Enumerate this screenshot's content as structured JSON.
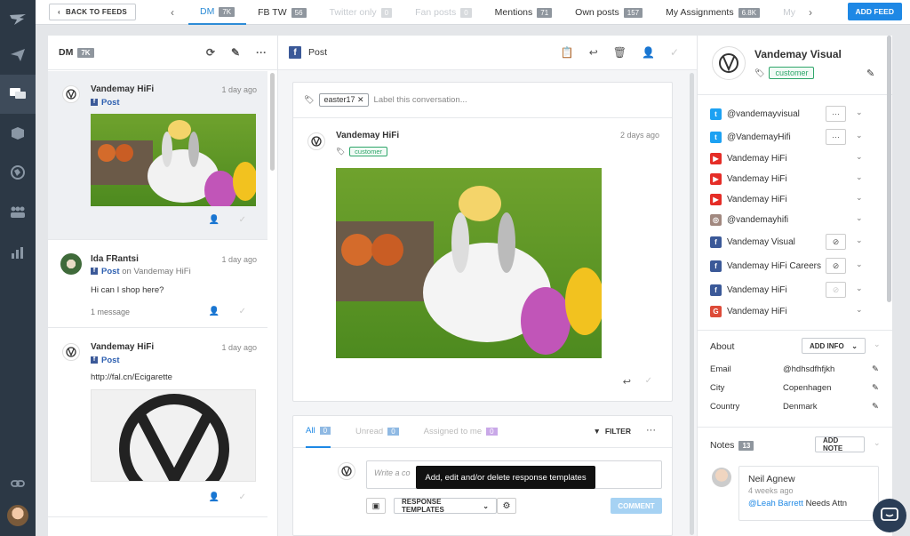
{
  "topbar": {
    "back_label": "BACK TO FEEDS",
    "tabs": [
      {
        "label": "DM",
        "count": "7K",
        "state": "active"
      },
      {
        "label": "FB TW",
        "count": "56",
        "state": "normal"
      },
      {
        "label": "Twitter only",
        "count": "0",
        "state": "disabled"
      },
      {
        "label": "Fan posts",
        "count": "0",
        "state": "disabled"
      },
      {
        "label": "Mentions",
        "count": "71",
        "state": "normal"
      },
      {
        "label": "Own posts",
        "count": "157",
        "state": "normal"
      },
      {
        "label": "My Assignments",
        "count": "6.8K",
        "state": "normal"
      },
      {
        "label": "My",
        "count": "",
        "state": "disabled"
      }
    ],
    "add_feed": "ADD FEED"
  },
  "feed": {
    "title": "DM",
    "count": "7K",
    "items": [
      {
        "name": "Vandemay HiFi",
        "time": "1 day ago",
        "type": "Post",
        "suffix": ""
      },
      {
        "name": "Ida FRantsi",
        "time": "1 day ago",
        "type": "Post",
        "suffix": "on Vandemay HiFi",
        "text": "Hi can I shop here?",
        "meta": "1 message"
      },
      {
        "name": "Vandemay HiFi",
        "time": "1 day ago",
        "type": "Post",
        "suffix": "",
        "text": "http://fal.cn/Ecigarette"
      }
    ]
  },
  "conversation": {
    "title": "Post",
    "tag": "easter17",
    "label_placeholder": "Label this conversation...",
    "post_author": "Vandemay HiFi",
    "post_time": "2 days ago",
    "post_tag": "customer",
    "tabs": [
      {
        "label": "All",
        "count": "0"
      },
      {
        "label": "Unread",
        "count": "0"
      },
      {
        "label": "Assigned to me",
        "count": "0"
      }
    ],
    "filter": "FILTER",
    "comment_placeholder": "Write a co",
    "tooltip": "Add, edit and/or delete response templates",
    "templates": "RESPONSE TEMPLATES",
    "comment_btn": "COMMENT"
  },
  "profile": {
    "name": "Vandemay Visual",
    "tag": "customer",
    "accounts": [
      {
        "net": "twitter",
        "name": "@vandemayvisual",
        "btn": "···"
      },
      {
        "net": "twitter",
        "name": "@VandemayHifi",
        "btn": "···"
      },
      {
        "net": "youtube",
        "name": "Vandemay HiFi",
        "btn": ""
      },
      {
        "net": "youtube",
        "name": "Vandemay HiFi",
        "btn": ""
      },
      {
        "net": "youtube",
        "name": "Vandemay HiFi",
        "btn": ""
      },
      {
        "net": "instagram",
        "name": "@vandemayhifi",
        "btn": ""
      },
      {
        "net": "facebook",
        "name": "Vandemay Visual",
        "btn": "⊘"
      },
      {
        "net": "facebook",
        "name": "Vandemay HiFi Careers",
        "btn": "⊘"
      },
      {
        "net": "facebook",
        "name": "Vandemay HiFi",
        "btn": "⊘"
      },
      {
        "net": "google",
        "name": "Vandemay HiFi",
        "btn": ""
      }
    ],
    "about_title": "About",
    "add_info": "ADD INFO",
    "about": [
      {
        "k": "Email",
        "v": "@hdhsdfhfjkh"
      },
      {
        "k": "City",
        "v": "Copenhagen"
      },
      {
        "k": "Country",
        "v": "Denmark"
      }
    ],
    "notes_title": "Notes",
    "notes_count": "13",
    "add_note": "ADD NOTE",
    "note_author": "Neil Agnew",
    "note_time": "4 weeks ago",
    "note_mention": "@Leah Barrett",
    "note_text": "Needs Attn"
  },
  "colors": {
    "accent": "#1e88e5",
    "nav": "#2c3845",
    "facebook": "#3b5998",
    "twitter": "#1da1f2",
    "youtube": "#e52d27",
    "instagram": "#a1887f",
    "google": "#dd4b39"
  }
}
